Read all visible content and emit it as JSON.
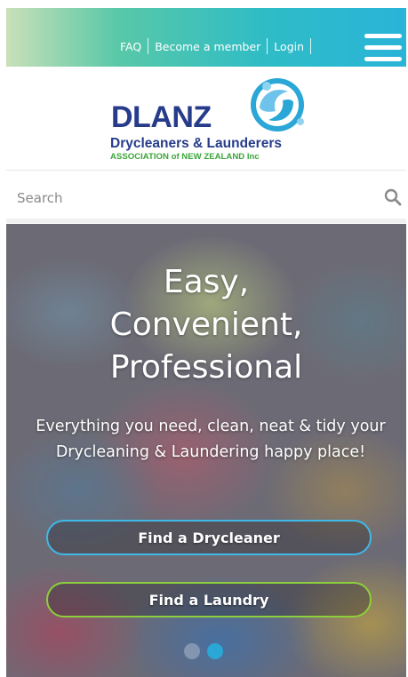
{
  "header": {
    "links": [
      {
        "label": "FAQ"
      },
      {
        "label": "Become a member"
      },
      {
        "label": "Login"
      }
    ],
    "menu_icon": "hamburger-menu-icon"
  },
  "logo": {
    "name": "DLANZ",
    "line1": "Drycleaners & Launderers",
    "line2": "ASSOCIATION of NEW ZEALAND Inc",
    "colors": {
      "navy": "#263c8b",
      "green": "#3aa539",
      "blue": "#2aa7d6"
    }
  },
  "search": {
    "placeholder": "Search",
    "icon": "search-icon"
  },
  "hero": {
    "title": "Easy,\nConvenient,\nProfessional",
    "text": "Everything you need, clean, neat & tidy your Drycleaning & Laundering happy place!",
    "buttons": {
      "drycleaner": "Find a Drycleaner",
      "laundry": "Find a Laundry"
    },
    "carousel": {
      "slides": 2,
      "active_slide": 2
    }
  },
  "colors": {
    "accent_blue": "#3fb9e8",
    "accent_green": "#8ccf3c",
    "header_gradient_start": "#c9e0b8",
    "header_gradient_end": "#29b4d8"
  }
}
